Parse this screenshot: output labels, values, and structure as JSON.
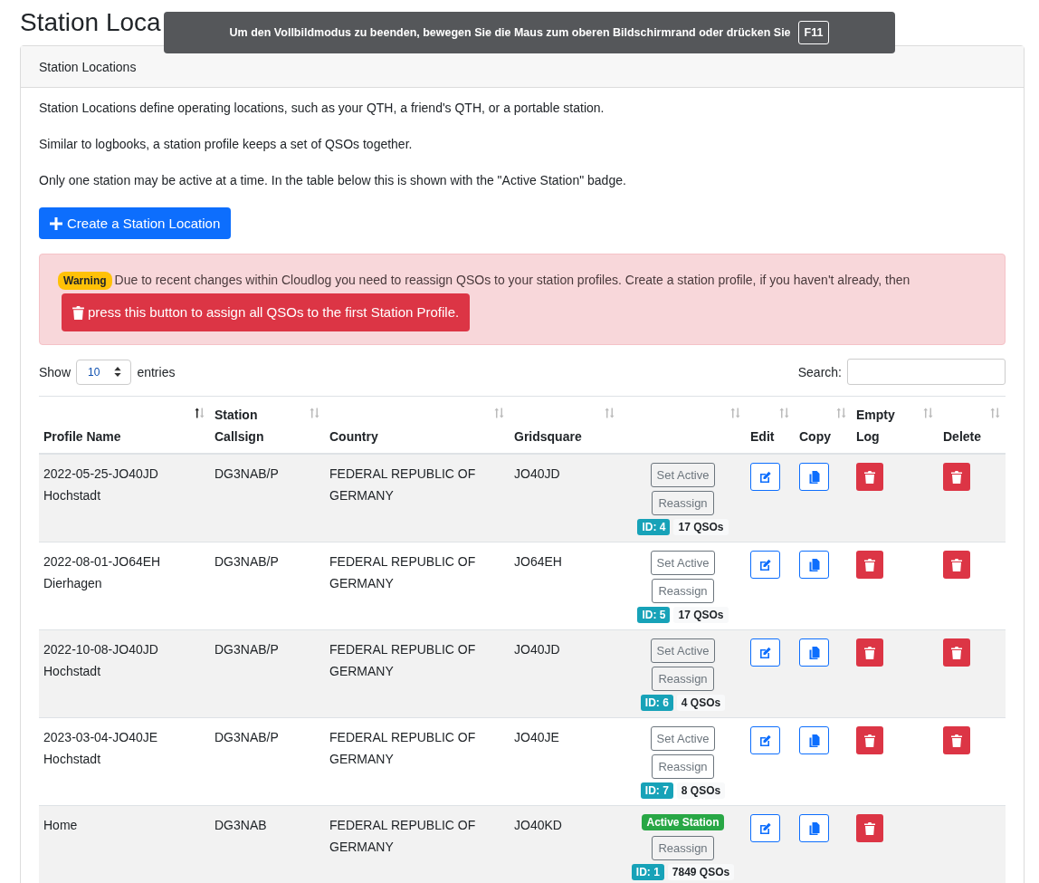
{
  "page_title": "Station Loca",
  "fullscreen_notice": {
    "text": "Um den Vollbildmodus zu beenden, bewegen Sie die Maus zum oberen Bildschirmrand oder drücken Sie",
    "key": "F11"
  },
  "card": {
    "header": "Station Locations",
    "paragraphs": [
      "Station Locations define operating locations, such as your QTH, a friend's QTH, or a portable station.",
      "Similar to logbooks, a station profile keeps a set of QSOs together.",
      "Only one station may be active at a time. In the table below this is shown with the \"Active Station\" badge."
    ],
    "create_button": "Create a Station Location",
    "warning": {
      "badge": "Warning",
      "text": "Due to recent changes within Cloudlog you need to reassign QSOs to your station profiles. Create a station profile, if you haven't already, then",
      "button": "press this button to assign all QSOs to the first Station Profile."
    },
    "table": {
      "length": {
        "label_before": "Show",
        "value": "10",
        "label_after": "entries"
      },
      "search": {
        "label": "Search:"
      },
      "columns": [
        {
          "label": "Profile Name",
          "sorted": true
        },
        {
          "label": "Station Callsign",
          "sorted": false
        },
        {
          "label": "Country",
          "sorted": false
        },
        {
          "label": "Gridsquare",
          "sorted": false
        },
        {
          "sorted": false
        },
        {
          "label": "Edit",
          "sorted": false
        },
        {
          "label": "Copy",
          "sorted": false
        },
        {
          "label": "Empty Log",
          "sorted": false
        },
        {
          "label": "Delete",
          "sorted": false
        }
      ],
      "rows": [
        {
          "profile_name": "2022-05-25-JO40JD Hochstadt",
          "callsign": "DG3NAB/P",
          "country": "FEDERAL REPUBLIC OF GERMANY",
          "gridsquare": "JO40JD",
          "active": false,
          "status_label": "Set Active",
          "reassign": "Reassign",
          "id": "ID: 4",
          "qsos": "17 QSOs"
        },
        {
          "profile_name": "2022-08-01-JO64EH Dierhagen",
          "callsign": "DG3NAB/P",
          "country": "FEDERAL REPUBLIC OF GERMANY",
          "gridsquare": "JO64EH",
          "active": false,
          "status_label": "Set Active",
          "reassign": "Reassign",
          "id": "ID: 5",
          "qsos": "17 QSOs"
        },
        {
          "profile_name": "2022-10-08-JO40JD Hochstadt",
          "callsign": "DG3NAB/P",
          "country": "FEDERAL REPUBLIC OF GERMANY",
          "gridsquare": "JO40JD",
          "active": false,
          "status_label": "Set Active",
          "reassign": "Reassign",
          "id": "ID: 6",
          "qsos": "4 QSOs"
        },
        {
          "profile_name": "2023-03-04-JO40JE Hochstadt",
          "callsign": "DG3NAB/P",
          "country": "FEDERAL REPUBLIC OF GERMANY",
          "gridsquare": "JO40JE",
          "active": false,
          "status_label": "Set Active",
          "reassign": "Reassign",
          "id": "ID: 7",
          "qsos": "8 QSOs"
        },
        {
          "profile_name": "Home",
          "callsign": "DG3NAB",
          "country": "FEDERAL REPUBLIC OF GERMANY",
          "gridsquare": "JO40KD",
          "active": true,
          "status_label": "Active Station",
          "reassign": "Reassign",
          "id": "ID: 1",
          "qsos": "7849 QSOs"
        }
      ]
    }
  }
}
